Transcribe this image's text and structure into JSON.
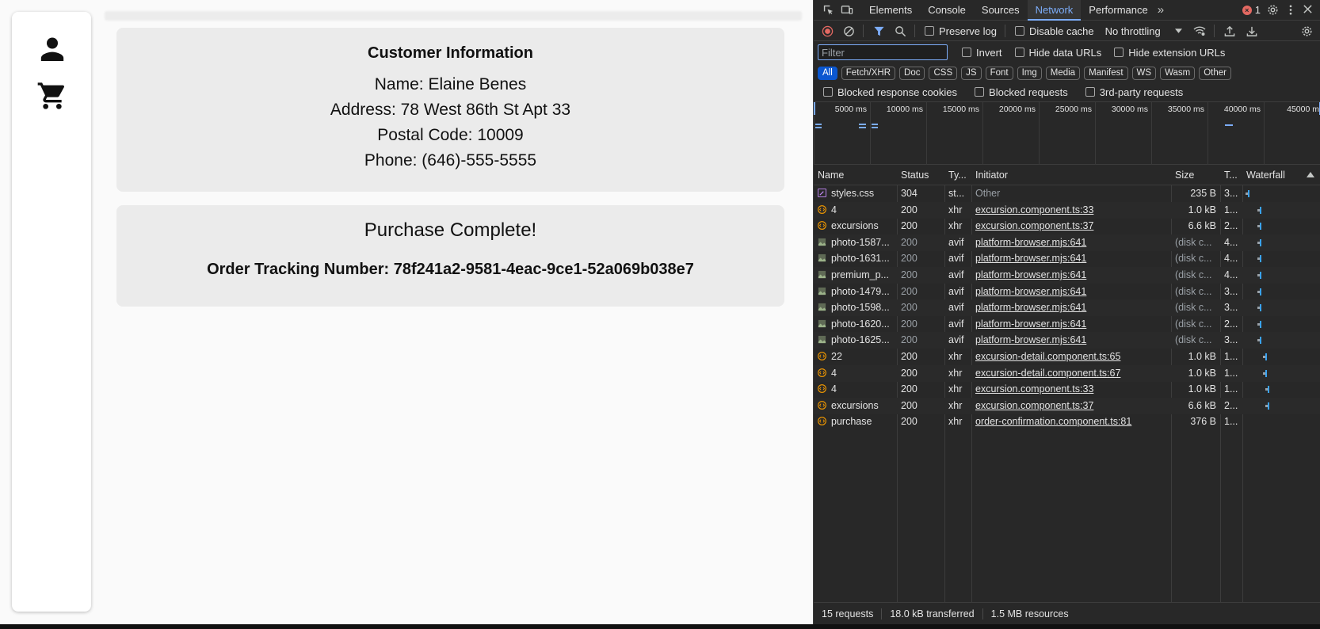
{
  "app": {
    "sidebar": {
      "icons": [
        "person-icon",
        "cart-icon"
      ]
    },
    "customer_info": {
      "title": "Customer Information",
      "name": "Name: Elaine Benes",
      "address": "Address: 78 West 86th St Apt 33",
      "postal": "Postal Code: 10009",
      "phone": "Phone: (646)-555-5555"
    },
    "purchase": {
      "title": "Purchase Complete!",
      "tracking": "Order Tracking Number: 78f241a2-9581-4eac-9ce1-52a069b038e7"
    }
  },
  "devtools": {
    "tabs": [
      "Elements",
      "Console",
      "Sources",
      "Network",
      "Performance"
    ],
    "active_tab": "Network",
    "error_count": "1",
    "toolbar": {
      "preserve_log": "Preserve log",
      "disable_cache": "Disable cache",
      "throttling": "No throttling"
    },
    "filter": {
      "placeholder": "Filter",
      "invert": "Invert",
      "hide_data_urls": "Hide data URLs",
      "hide_extension_urls": "Hide extension URLs"
    },
    "type_filters": [
      "All",
      "Fetch/XHR",
      "Doc",
      "CSS",
      "JS",
      "Font",
      "Img",
      "Media",
      "Manifest",
      "WS",
      "Wasm",
      "Other"
    ],
    "blocked": {
      "cookies": "Blocked response cookies",
      "requests": "Blocked requests",
      "third_party": "3rd-party requests"
    },
    "timeline_ticks": [
      "5000 ms",
      "10000 ms",
      "15000 ms",
      "20000 ms",
      "25000 ms",
      "30000 ms",
      "35000 ms",
      "40000 ms",
      "45000 m"
    ],
    "columns": [
      "Name",
      "Status",
      "Ty...",
      "Initiator",
      "Size",
      "T...",
      "Waterfall"
    ],
    "requests": [
      {
        "name": "styles.css",
        "status": "304",
        "type": "st...",
        "initiator": "Other",
        "size": "235 B",
        "time": "3...",
        "icon": "css-file-icon"
      },
      {
        "name": "4",
        "status": "200",
        "type": "xhr",
        "initiator": "excursion.component.ts:33",
        "size": "1.0 kB",
        "time": "1...",
        "icon": "xhr-icon"
      },
      {
        "name": "excursions",
        "status": "200",
        "type": "xhr",
        "initiator": "excursion.component.ts:37",
        "size": "6.6 kB",
        "time": "2...",
        "icon": "xhr-icon"
      },
      {
        "name": "photo-1587...",
        "status": "200",
        "type": "avif",
        "initiator": "platform-browser.mjs:641",
        "size": "(disk c...",
        "time": "4...",
        "icon": "image-icon"
      },
      {
        "name": "photo-1631...",
        "status": "200",
        "type": "avif",
        "initiator": "platform-browser.mjs:641",
        "size": "(disk c...",
        "time": "4...",
        "icon": "image-icon"
      },
      {
        "name": "premium_p...",
        "status": "200",
        "type": "avif",
        "initiator": "platform-browser.mjs:641",
        "size": "(disk c...",
        "time": "4...",
        "icon": "image-icon"
      },
      {
        "name": "photo-1479...",
        "status": "200",
        "type": "avif",
        "initiator": "platform-browser.mjs:641",
        "size": "(disk c...",
        "time": "3...",
        "icon": "image-icon"
      },
      {
        "name": "photo-1598...",
        "status": "200",
        "type": "avif",
        "initiator": "platform-browser.mjs:641",
        "size": "(disk c...",
        "time": "3...",
        "icon": "image-icon"
      },
      {
        "name": "photo-1620...",
        "status": "200",
        "type": "avif",
        "initiator": "platform-browser.mjs:641",
        "size": "(disk c...",
        "time": "2...",
        "icon": "image-icon"
      },
      {
        "name": "photo-1625...",
        "status": "200",
        "type": "avif",
        "initiator": "platform-browser.mjs:641",
        "size": "(disk c...",
        "time": "3...",
        "icon": "image-icon"
      },
      {
        "name": "22",
        "status": "200",
        "type": "xhr",
        "initiator": "excursion-detail.component.ts:65",
        "size": "1.0 kB",
        "time": "1...",
        "icon": "xhr-icon"
      },
      {
        "name": "4",
        "status": "200",
        "type": "xhr",
        "initiator": "excursion-detail.component.ts:67",
        "size": "1.0 kB",
        "time": "1...",
        "icon": "xhr-icon"
      },
      {
        "name": "4",
        "status": "200",
        "type": "xhr",
        "initiator": "excursion.component.ts:33",
        "size": "1.0 kB",
        "time": "1...",
        "icon": "xhr-icon"
      },
      {
        "name": "excursions",
        "status": "200",
        "type": "xhr",
        "initiator": "excursion.component.ts:37",
        "size": "6.6 kB",
        "time": "2...",
        "icon": "xhr-icon"
      },
      {
        "name": "purchase",
        "status": "200",
        "type": "xhr",
        "initiator": "order-confirmation.component.ts:81",
        "size": "376 B",
        "time": "1...",
        "icon": "xhr-icon"
      }
    ],
    "status_bar": {
      "requests": "15 requests",
      "transferred": "18.0 kB transferred",
      "resources": "1.5 MB resources"
    },
    "colors": {
      "accent": "#7cacf8",
      "chip_active": "#0b57d0",
      "waterfall": "#3ba3f0",
      "error": "#e46962"
    }
  }
}
